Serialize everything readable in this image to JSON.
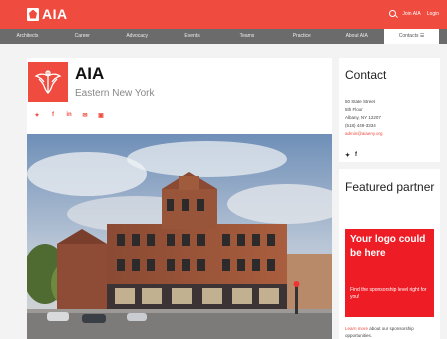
{
  "header": {
    "logo_text": "AIA",
    "join_label": "Join AIA",
    "login_label": "Login"
  },
  "nav": {
    "items": [
      {
        "label": "Architects"
      },
      {
        "label": "Career"
      },
      {
        "label": "Advocacy"
      },
      {
        "label": "Events"
      },
      {
        "label": "Teams"
      },
      {
        "label": "Practice"
      },
      {
        "label": "About AIA"
      },
      {
        "label": "Contacts ☰"
      }
    ]
  },
  "chapter": {
    "title": "AIA",
    "subtitle": "Eastern New York",
    "share_icons": [
      "twitter-icon",
      "facebook-icon",
      "linkedin-icon",
      "email-icon",
      "print-icon"
    ]
  },
  "contact": {
    "title": "Contact",
    "address_lines": [
      "50 State Street",
      "5th Floor",
      "Albany, NY 12207",
      "(518) 449-3334"
    ],
    "email": "admin@aiaeny.org"
  },
  "featured": {
    "title": "Featured partner",
    "promo_head": "Your logo could be here",
    "promo_body": "Find the sponsorship level right for you!",
    "learn_link": "Learn more",
    "learn_rest": " about our sponsorship opportunities."
  },
  "colors": {
    "brand_red": "#ef4b3f",
    "nav_gray": "#6b6b6b",
    "promo_red": "#ee1c25"
  }
}
